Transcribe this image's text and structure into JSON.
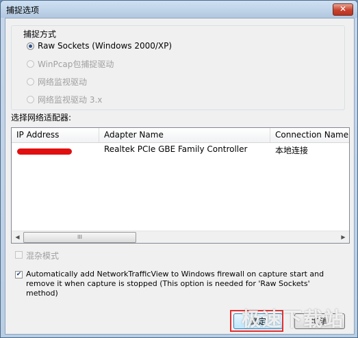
{
  "window": {
    "title": "捕捉选项",
    "close_label": "✕"
  },
  "capture_group": {
    "legend": "捕捉方式",
    "options": [
      {
        "label": "Raw Sockets (Windows 2000/XP)",
        "selected": true,
        "enabled": true
      },
      {
        "label": "WinPcap包捕捉驱动",
        "selected": false,
        "enabled": false
      },
      {
        "label": "网络监视驱动",
        "selected": false,
        "enabled": false
      },
      {
        "label": "网络监视驱动 3.x",
        "selected": false,
        "enabled": false
      }
    ]
  },
  "adapter_section": {
    "label": "选择网络适配器:",
    "columns": [
      "IP Address",
      "Adapter Name",
      "Connection Name"
    ],
    "rows": [
      {
        "ip": "",
        "adapter": "Realtek PCIe GBE Family Controller",
        "connection": "本地连接"
      }
    ],
    "scroll_left": "◀",
    "scroll_right": "▶",
    "thumb_grip": "III"
  },
  "promiscuous": {
    "label": "混杂模式",
    "checked": false,
    "enabled": false
  },
  "firewall": {
    "label": "Automatically add NetworkTrafficView to Windows firewall on capture start and remove it when capture is stopped (This option is needed for 'Raw Sockets' method)",
    "checked": true,
    "mark": "✔"
  },
  "buttons": {
    "ok": "确定",
    "cancel": "取消"
  },
  "watermark": "极速下载站"
}
